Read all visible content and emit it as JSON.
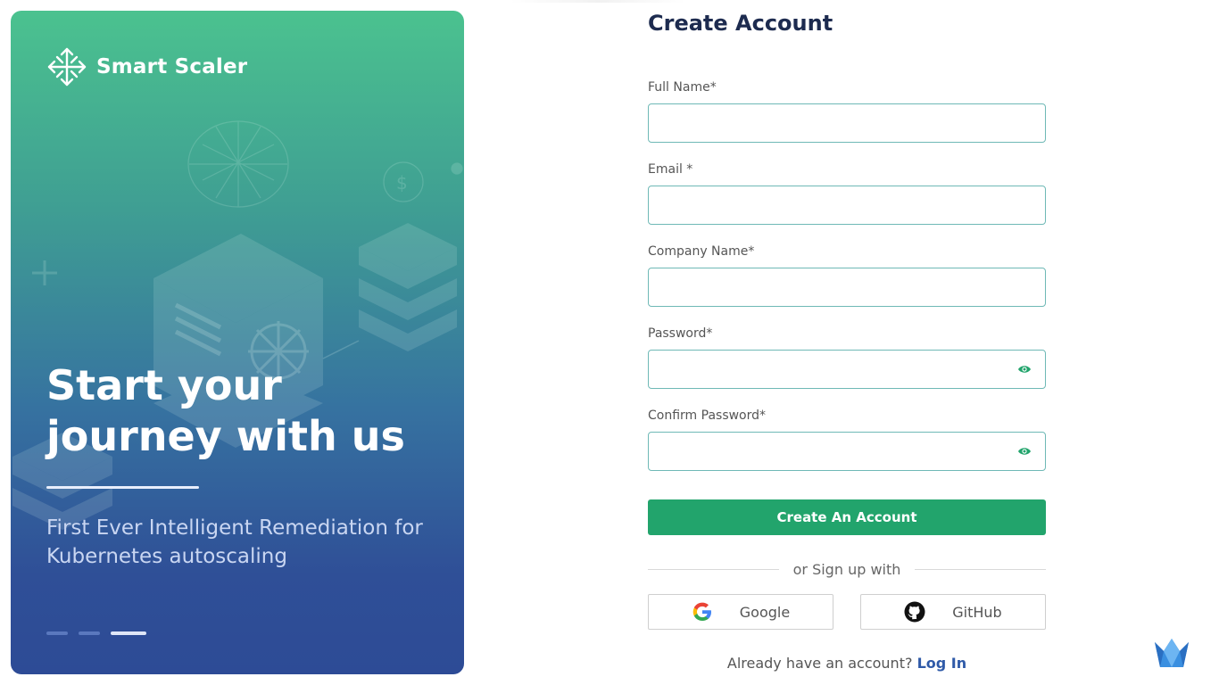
{
  "hero": {
    "brand_name": "Smart Scaler",
    "title": "Start your journey with us",
    "subtitle": "First Ever Intelligent Remediation for Kubernetes autoscaling",
    "slides": 3,
    "active_slide": 3
  },
  "form": {
    "title": "Create Account",
    "fields": [
      {
        "label": "Full Name*",
        "value": "",
        "type": "text"
      },
      {
        "label": "Email *",
        "value": "",
        "type": "email"
      },
      {
        "label": "Company Name*",
        "value": "",
        "type": "text"
      },
      {
        "label": "Password*",
        "value": "",
        "type": "password"
      },
      {
        "label": "Confirm Password*",
        "value": "",
        "type": "password"
      }
    ],
    "submit_label": "Create An Account",
    "divider_text": "or Sign up with",
    "social": {
      "google_label": "Google",
      "github_label": "GitHub"
    },
    "login_prompt": "Already have an account?",
    "login_link": "Log In"
  },
  "colors": {
    "primary_green": "#22a46c",
    "input_border": "#6fb9b6",
    "link_blue": "#2f5aa8",
    "title_navy": "#1d2b4f"
  },
  "icons": {
    "brand": "arrows-expand-icon",
    "eye": "eye-icon",
    "google": "google-icon",
    "github": "github-icon",
    "corner": "crown-icon"
  }
}
